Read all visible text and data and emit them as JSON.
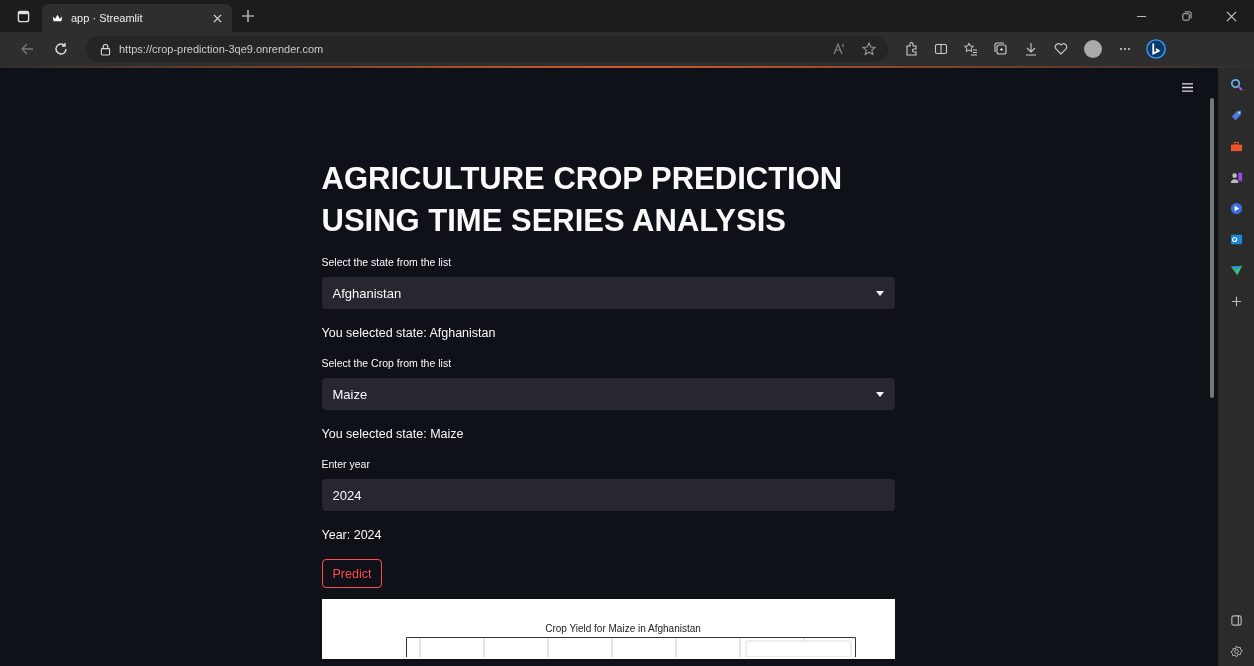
{
  "browser": {
    "tab_title": "app · Streamlit",
    "url": "https://crop-prediction-3qe9.onrender.com"
  },
  "app": {
    "title": "AGRICULTURE CROP PREDICTION USING TIME SERIES ANALYSIS",
    "controls": [
      {
        "kind": "select",
        "label": "Select the state from the list",
        "value": "Afghanistan"
      },
      {
        "kind": "text",
        "text": "You selected state: Afghanistan"
      },
      {
        "kind": "select",
        "label": "Select the Crop from the list",
        "value": "Maize"
      },
      {
        "kind": "text",
        "text": "You selected state: Maize"
      },
      {
        "kind": "input",
        "label": "Enter year",
        "value": "2024"
      },
      {
        "kind": "text",
        "text": "Year: 2024"
      },
      {
        "kind": "button",
        "label": "Predict"
      }
    ],
    "chart": {
      "title": "Crop Yield for Maize in Afghanistan"
    }
  }
}
